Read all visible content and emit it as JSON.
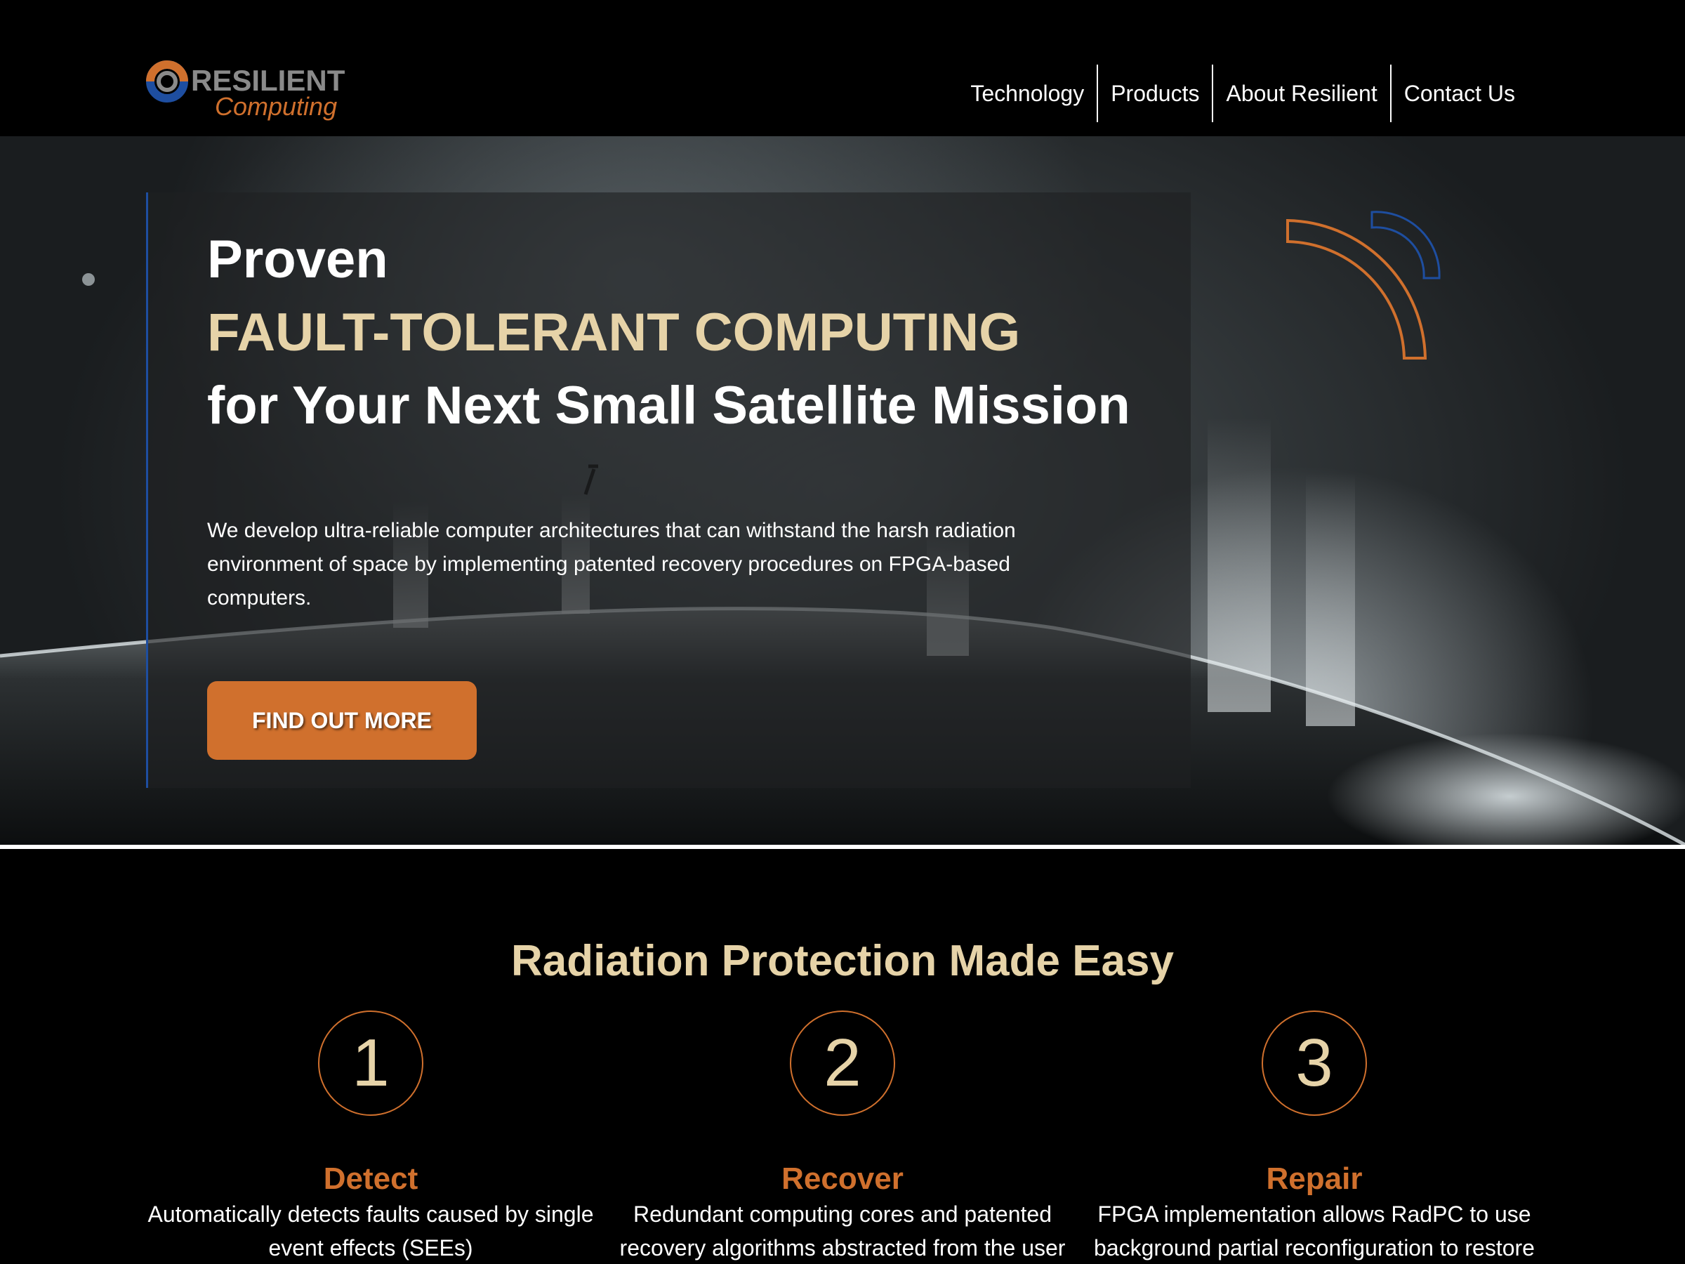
{
  "brand": {
    "logo_text": "RESILIENT",
    "logo_sub": "Computing"
  },
  "nav": {
    "items": [
      {
        "label": "Technology"
      },
      {
        "label": "Products"
      },
      {
        "label": "About Resilient"
      },
      {
        "label": "Contact Us"
      }
    ]
  },
  "hero": {
    "title_line1": "Proven",
    "title_accent": "FAULT-TOLERANT COMPUTING",
    "title_line3": "for Your Next Small Satellite Mission",
    "description": "We develop ultra-reliable computer architectures that can withstand the harsh radiation environment of space by implementing patented recovery procedures on FPGA-based computers.",
    "cta_label": "FIND OUT MORE"
  },
  "section": {
    "title": "Radiation Protection Made Easy",
    "steps": [
      {
        "number": "1",
        "name": "Detect",
        "text": "Automatically detects faults caused by single event effects (SEEs)"
      },
      {
        "number": "2",
        "name": "Recover",
        "text": "Redundant computing cores and patented recovery algorithms abstracted from the user"
      },
      {
        "number": "3",
        "name": "Repair",
        "text": "FPGA implementation allows RadPC to use background partial reconfiguration to restore"
      }
    ]
  },
  "colors": {
    "accent_orange": "#d0702d",
    "accent_gold": "#e6d3a8",
    "accent_blue": "#1e4ea0"
  },
  "icons": {
    "logo_mark": "ring-logo-icon",
    "hero_decoration": "signal-arcs-icon"
  }
}
